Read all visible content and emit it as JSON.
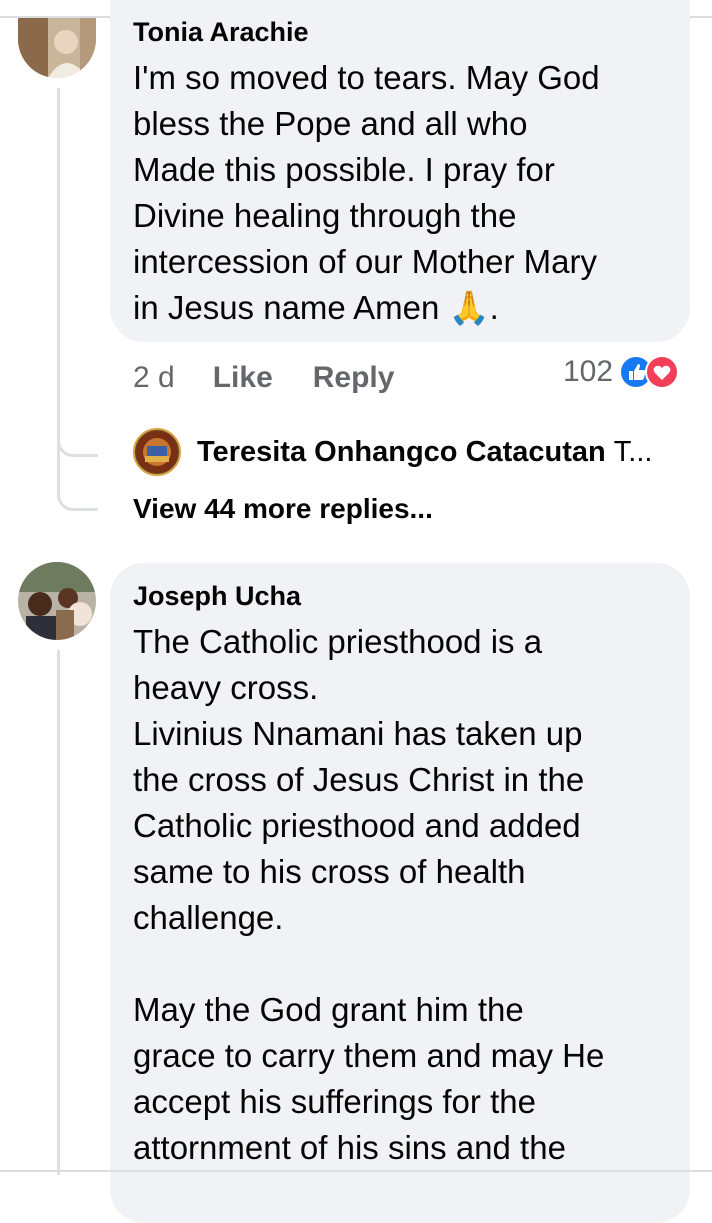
{
  "comment1": {
    "author": "Tonia Arachie",
    "text_lines": [
      "I'm so moved to tears. May God",
      "bless the Pope and all who",
      "Made this possible. I pray for",
      "Divine healing through the",
      "intercession of our Mother Mary",
      "in Jesus name Amen"
    ],
    "emoji": "🙏",
    "trailing": ".",
    "time": "2 d",
    "like_label": "Like",
    "reply_label": "Reply",
    "reaction_count": "102",
    "reaction_icons": [
      "like-icon",
      "love-icon"
    ],
    "reply_preview": {
      "author": "Teresita Onhangco Catacutan",
      "snippet": "T..."
    },
    "view_more_label": "View 44 more replies..."
  },
  "comment2": {
    "author": "Joseph Ucha",
    "text_lines": [
      "The Catholic priesthood is a",
      "heavy cross.",
      "Livinius Nnamani has taken up",
      "the cross of Jesus Christ in the",
      "Catholic priesthood and added",
      "same to his cross of health",
      "challenge.",
      "",
      "May the God grant him the",
      "grace to carry them and may He",
      "accept his sufferings for the",
      "attornment of his sins and the"
    ]
  },
  "colors": {
    "bubble": "#f0f2f5",
    "meta_text": "#65676b",
    "like_blue": "#1877f2",
    "love_red": "#f33e58"
  }
}
